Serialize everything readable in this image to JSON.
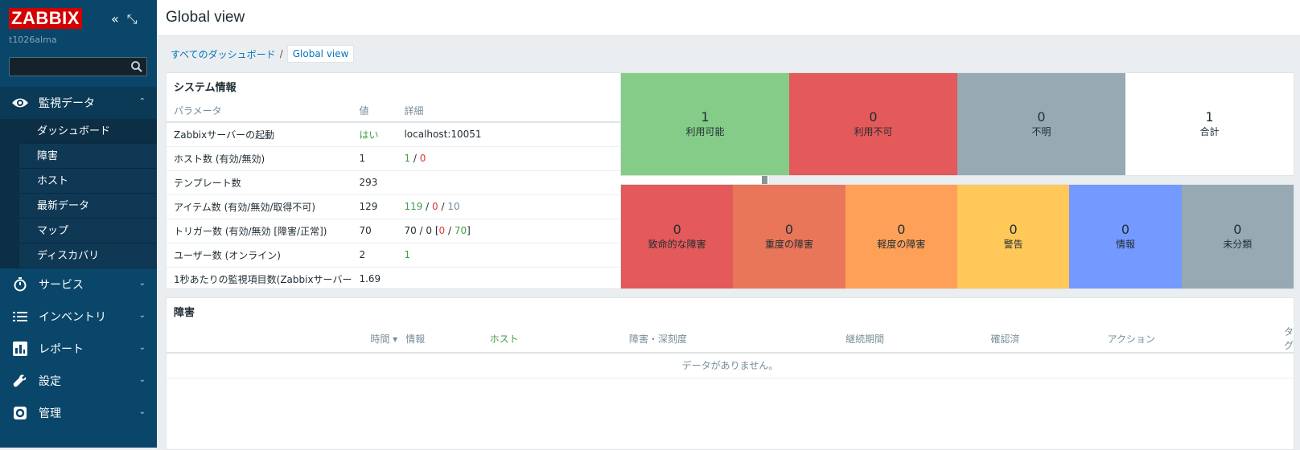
{
  "sidebar": {
    "logo": "ZABBIX",
    "hostname": "t1026alma",
    "search_placeholder": "",
    "menu": [
      {
        "label": "監視データ",
        "icon": "eye-icon"
      },
      {
        "label": "サービス",
        "icon": "stopwatch-icon"
      },
      {
        "label": "インベントリ",
        "icon": "list-icon"
      },
      {
        "label": "レポート",
        "icon": "bar-chart-icon"
      },
      {
        "label": "設定",
        "icon": "wrench-icon"
      },
      {
        "label": "管理",
        "icon": "gear-icon"
      }
    ],
    "submenu": [
      "ダッシュボード",
      "障害",
      "ホスト",
      "最新データ",
      "マップ",
      "ディスカバリ"
    ]
  },
  "page": {
    "title": "Global view",
    "breadcrumb": {
      "root": "すべてのダッシュボード",
      "sep": "/",
      "current": "Global view"
    }
  },
  "sysinfo": {
    "title": "システム情報",
    "headers": [
      "パラメータ",
      "値",
      "詳細"
    ],
    "rows": [
      {
        "param": "Zabbixサーバーの起動",
        "value": "はい",
        "d1": "localhost:10051",
        "d2": "",
        "d3": "",
        "d4": "",
        "d5": "",
        "d6": "",
        "d7": ""
      },
      {
        "param": "ホスト数 (有効/無効)",
        "value": "1",
        "d1": "",
        "d2": "1",
        "d3": " / ",
        "d4": "0",
        "d5": "",
        "d6": "",
        "d7": ""
      },
      {
        "param": "テンプレート数",
        "value": "293",
        "d1": "",
        "d2": "",
        "d3": "",
        "d4": "",
        "d5": "",
        "d6": "",
        "d7": ""
      },
      {
        "param": "アイテム数 (有効/無効/取得不可)",
        "value": "129",
        "d1": "",
        "d2": "119",
        "d3": " / ",
        "d4": "0",
        "d5": " / ",
        "d6": "10",
        "d7": ""
      },
      {
        "param": "トリガー数 (有効/無効 [障害/正常])",
        "value": "70",
        "d1": "70 / 0 [",
        "d2": "",
        "d3": "",
        "d4": "0",
        "d5": " / ",
        "d6": "",
        "d7": "70"
      },
      {
        "param": "ユーザー数 (オンライン)",
        "value": "2",
        "d1": "",
        "d2": "1",
        "d3": "",
        "d4": "",
        "d5": "",
        "d6": "",
        "d7": ""
      },
      {
        "param": "1秒あたりの監視項目数(Zabbixサーバー",
        "value": "1.69",
        "d1": "",
        "d2": "",
        "d3": "",
        "d4": "",
        "d5": "",
        "d6": "",
        "d7": ""
      }
    ],
    "trigger_close": "]"
  },
  "availability": [
    {
      "count": "1",
      "label": "利用可能",
      "color": "#86cc89",
      "text": "#1f2c33"
    },
    {
      "count": "0",
      "label": "利用不可",
      "color": "#e45959",
      "text": "#1f2c33"
    },
    {
      "count": "0",
      "label": "不明",
      "color": "#97aab3",
      "text": "#1f2c33"
    },
    {
      "count": "1",
      "label": "合計",
      "color": "#ffffff",
      "text": "#1f2c33"
    }
  ],
  "severity": [
    {
      "count": "0",
      "label": "致命的な障害",
      "color": "#e45959"
    },
    {
      "count": "0",
      "label": "重度の障害",
      "color": "#e97659"
    },
    {
      "count": "0",
      "label": "軽度の障害",
      "color": "#ffa059"
    },
    {
      "count": "0",
      "label": "警告",
      "color": "#ffc859"
    },
    {
      "count": "0",
      "label": "情報",
      "color": "#7499ff"
    },
    {
      "count": "0",
      "label": "未分類",
      "color": "#97aab3"
    }
  ],
  "problems": {
    "title": "障害",
    "headers": [
      "時間 ▾",
      "情報",
      "ホスト",
      "障害・深刻度",
      "継続期間",
      "確認済",
      "アクション",
      "タグ"
    ],
    "empty": "データがありません。"
  }
}
